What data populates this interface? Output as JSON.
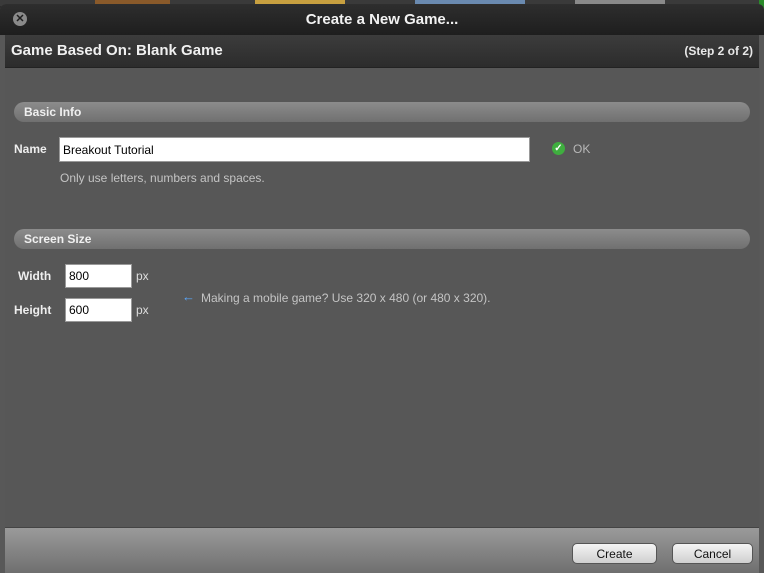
{
  "window": {
    "title": "Create a New Game..."
  },
  "header": {
    "title": "Game Based On: Blank Game",
    "step": "(Step 2 of 2)"
  },
  "basic_info": {
    "section_label": "Basic Info",
    "name_label": "Name",
    "name_value": "Breakout Tutorial",
    "validation_status": "OK",
    "hint": "Only use letters, numbers and spaces."
  },
  "screen_size": {
    "section_label": "Screen Size",
    "width_label": "Width",
    "width_value": "800",
    "height_label": "Height",
    "height_value": "600",
    "unit": "px",
    "mobile_hint": "Making a mobile game? Use 320 x 480 (or 480 x 320)."
  },
  "footer": {
    "create_label": "Create",
    "cancel_label": "Cancel"
  },
  "icons": {
    "close": "close-icon",
    "ok": "checkmark-icon",
    "hint": "arrow-left-icon"
  },
  "colors": {
    "ok_green": "#3fae3f",
    "hint_blue": "#5aa8ff",
    "panel_bg": "#575757"
  }
}
